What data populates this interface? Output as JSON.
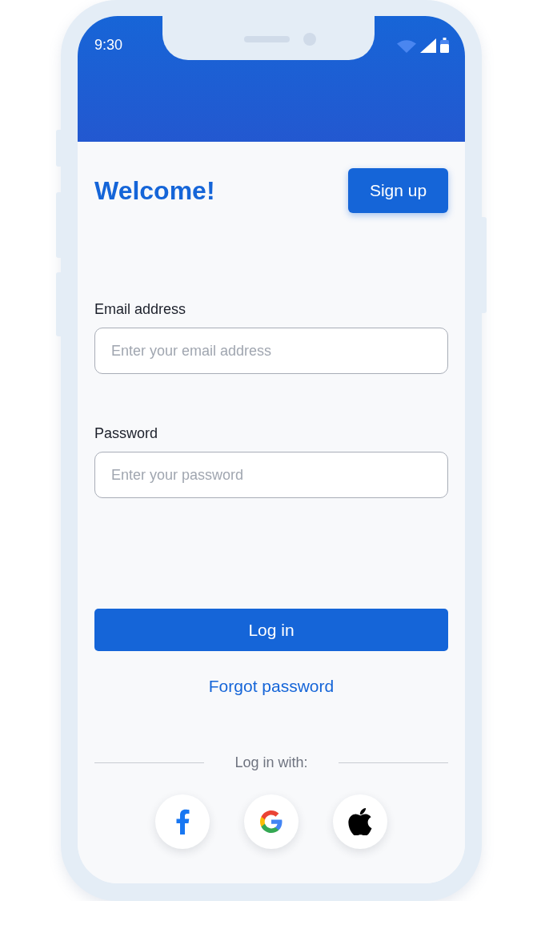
{
  "status_bar": {
    "time": "9:30"
  },
  "header": {
    "title": "Welcome!",
    "signup_button": "Sign up"
  },
  "fields": [
    {
      "label": "Email address",
      "placeholder": "Enter your email address"
    },
    {
      "label": "Password",
      "placeholder": "Enter your password"
    }
  ],
  "login_button": "Log in",
  "forgot_link": "Forgot password",
  "social": {
    "label": "Log in with:",
    "providers": [
      {
        "kind": "facebook"
      },
      {
        "kind": "google"
      },
      {
        "kind": "apple"
      }
    ]
  }
}
